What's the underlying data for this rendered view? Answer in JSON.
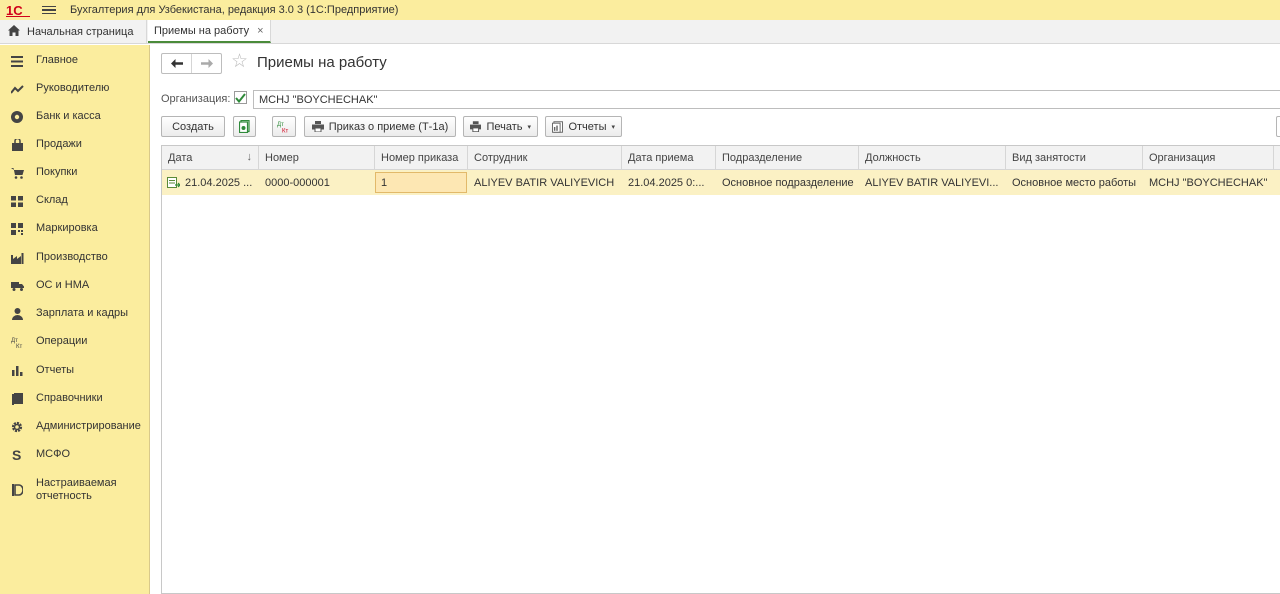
{
  "app": {
    "logo_text": "1С",
    "title": "Бухгалтерия для Узбекистана, редакция 3.0 3   (1С:Предприятие)"
  },
  "tabs": {
    "home_label": "Начальная страница",
    "active_label": "Приемы на работу",
    "close_glyph": "×"
  },
  "sidebar": {
    "items": [
      {
        "label": "Главное",
        "icon": "menu-list-icon"
      },
      {
        "label": "Руководителю",
        "icon": "trend-icon"
      },
      {
        "label": "Банк и касса",
        "icon": "coin-icon"
      },
      {
        "label": "Продажи",
        "icon": "bag-icon"
      },
      {
        "label": "Покупки",
        "icon": "cart-icon"
      },
      {
        "label": "Склад",
        "icon": "warehouse-icon"
      },
      {
        "label": "Маркировка",
        "icon": "qr-icon"
      },
      {
        "label": "Производство",
        "icon": "factory-icon"
      },
      {
        "label": "ОС и НМА",
        "icon": "truck-icon"
      },
      {
        "label": "Зарплата и кадры",
        "icon": "person-icon"
      },
      {
        "label": "Операции",
        "icon": "dt-kt-icon"
      },
      {
        "label": "Отчеты",
        "icon": "bar-chart-icon"
      },
      {
        "label": "Справочники",
        "icon": "book-icon"
      },
      {
        "label": "Администрирование",
        "icon": "gear-icon"
      },
      {
        "label": "МСФО",
        "icon": "dollar-icon"
      },
      {
        "label": "Настраиваемая\nотчетность",
        "icon": "report-icon"
      }
    ]
  },
  "page": {
    "title": "Приемы на работу",
    "back_glyph": "🡐",
    "forward_glyph": "🡒",
    "star_glyph": "☆"
  },
  "filter": {
    "label": "Организация:",
    "checked": true,
    "value": "MCHJ \"BOYCHECHAK\""
  },
  "toolbar": {
    "create_label": "Создать",
    "dtkt_label": "Дт/Кт",
    "print_order_label": "Приказ о приеме (Т-1а)",
    "print_label": "Печать",
    "reports_label": "Отчеты",
    "dropdown_glyph": "▾"
  },
  "table": {
    "columns": [
      "Дата",
      "Номер",
      "Номер приказа",
      "Сотрудник",
      "Дата приема",
      "Подразделение",
      "Должность",
      "Вид занятости",
      "Организация"
    ],
    "sort_glyph": "↓",
    "rows": [
      {
        "date": "21.04.2025 ...",
        "number": "0000-000001",
        "order_number": "1",
        "employee": "ALIYEV BATIR VALIYEVICH",
        "hire_date": "21.04.2025 0:...",
        "department": "Основное подразделение",
        "position": "ALIYEV BATIR VALIYEVI...",
        "employment_type": "Основное место работы",
        "organization": "MCHJ \"BOYCHECHAK\""
      }
    ]
  },
  "colors": {
    "sidebar_bg": "#fbed9e",
    "row_highlight": "#fbf1c4",
    "accent_green": "#4a8b3a",
    "logo_red": "#d0021b"
  }
}
